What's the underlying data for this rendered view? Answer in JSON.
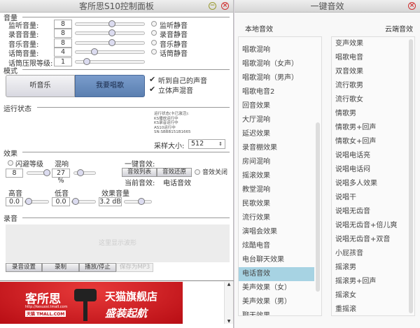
{
  "left_window": {
    "title": "客所思S10控制面板",
    "volume": {
      "section": "音量",
      "rows": [
        {
          "label": "监听音量:",
          "value": "8",
          "level": 0.53,
          "mute": "监听静音"
        },
        {
          "label": "录音音量:",
          "value": "8",
          "level": 0.53,
          "mute": "录音静音"
        },
        {
          "label": "音乐音量:",
          "value": "8",
          "level": 0.53,
          "mute": "音乐静音"
        },
        {
          "label": "话筒音量:",
          "value": "4",
          "level": 0.28,
          "mute": "话筒静音"
        },
        {
          "label": "话筒压限等级:",
          "value": "1",
          "level": 0.16,
          "mute": null
        }
      ]
    },
    "mode": {
      "section": "模式",
      "btn_music": "听音乐",
      "btn_sing": "我要唱歌",
      "check1": "听到自己的声音",
      "check2": "立体声混音"
    },
    "status": {
      "section": "运行状态",
      "lines": [
        "运行状态(卡已激活):",
        "KS播放运行中",
        "KS录音运行中",
        "AS10运行中",
        "SN:SBBB151B1665"
      ],
      "sample_label": "采样大小:",
      "sample_value": "512"
    },
    "effects": {
      "section": "效果",
      "duck_label": "闪避等级",
      "duck_value": "8",
      "reverb_label": "混响",
      "reverb_value": "27 %",
      "one_key_label": "一键音效:",
      "btn_list": "音效列表",
      "btn_restore": "音效还原",
      "off_label": "音效关闭",
      "current_label": "当前音效:",
      "current_value": "电话音效",
      "treble_label": "高音",
      "treble_value": "0.0",
      "bass_label": "低音",
      "bass_value": "0.0",
      "fxvol_label": "效果音量",
      "fxvol_value": "3.2 dB"
    },
    "record": {
      "section": "录音",
      "placeholder": "这里显示波形",
      "btn_settings": "录音设置",
      "btn_record": "录制",
      "btn_play": "播放/停止",
      "btn_save": "保存为MP3"
    },
    "banner": {
      "brand": "客所思",
      "url": "http://kesuosi.tmall.com",
      "tmall": "天猫 TMALL.COM",
      "store": "天猫旗舰店",
      "slogan": "盛装起航"
    }
  },
  "right_window": {
    "title": "一键音效",
    "local_label": "本地音效",
    "cloud_label": "云端音效",
    "local_items": [
      "唱歌混响",
      "唱歌混响（女声）",
      "唱歌混响（男声）",
      "唱歌电音2",
      "回音效果",
      "大厅混响",
      "延迟效果",
      "录音棚效果",
      "房间混响",
      "摇滚效果",
      "教堂混响",
      "民歌效果",
      "流行效果",
      "演唱会效果",
      "炫酷电音",
      "电台聊天效果",
      "电话音效",
      "美声效果（女）",
      "美声效果（男）",
      "聊天效果"
    ],
    "selected": "电话音效",
    "cloud_items": [
      "变声效果",
      "唱歌电音",
      "双音效果",
      "流行歌男",
      "流行歌女",
      "情歌男",
      "情歌男+回声",
      "情歌女+回声",
      "说唱电话亮",
      "说唱电话闷",
      "说唱多人效果",
      "说唱干",
      "说唱无齿音",
      "说唱无齿音+倍儿爽",
      "说唱无齿音+双音",
      "小屁孩音",
      "摇滚男",
      "摇滚男+回声",
      "摇滚女",
      "重摇滚"
    ]
  },
  "colors": {
    "accent": "#5a7fb0",
    "selected": "#a7d3e3",
    "banner": "#c8141c"
  }
}
